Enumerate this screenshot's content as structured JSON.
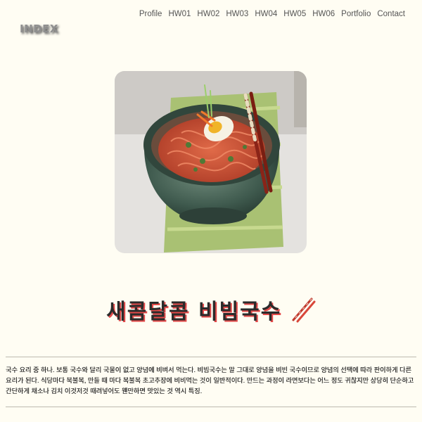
{
  "logo": "INDEX",
  "nav": [
    "Profile",
    "HW01",
    "HW02",
    "HW03",
    "HW04",
    "HW05",
    "HW06",
    "Portfolio",
    "Contact"
  ],
  "title": "새콤달콤 비빔국수",
  "description": "국수 요리 중 하나. 보통 국수와 달리 국물이 없고 양념에 비벼서 먹는다. 비빔국수는 말 그대로 양념을 비빈 국수이므로 양념의 선택에 따라 판이하게 다른 요리가 된다. 식당마다 북불복, 만들 때 마다 복불복 초고추장에 비비먹는 것이 일반적이다. 만드는 과정이 라면보다는 어느 정도 귀찮지만 상당히 단순하고 간단하게 채소나 김치 이것저것 때려넣어도 웬만하면 맛있는 것 역시 특징.",
  "icons": {
    "dish_photo": "bibim-guksu-photo",
    "title_icon": "chopsticks-icon"
  },
  "colors": {
    "background": "#fffdf3",
    "title_shadow": "#e34a4a"
  }
}
